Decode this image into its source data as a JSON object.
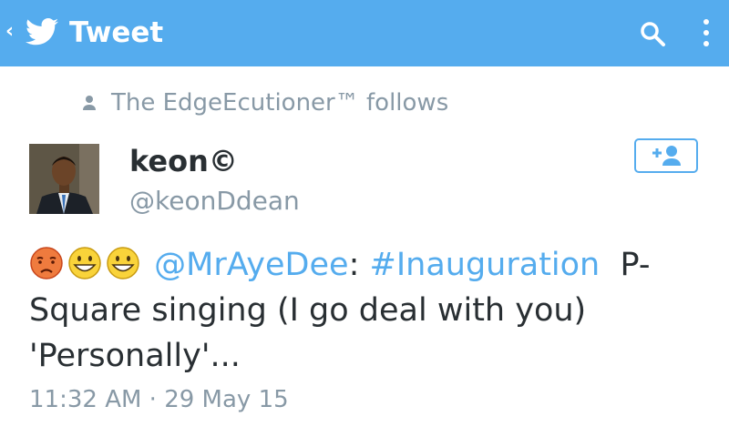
{
  "appbar": {
    "back_glyph": "‹",
    "logo_icon": "twitter-bird-icon",
    "title": "Tweet",
    "search_icon": "search-icon",
    "overflow_icon": "overflow-menu-icon",
    "bg_color": "#55acee"
  },
  "social_context": {
    "icon": "person-icon",
    "text": "The EdgeEcutioner™ follows"
  },
  "author": {
    "name": "keon©",
    "handle": "@keonDdean",
    "follow_icon": "follow-user-icon"
  },
  "tweet": {
    "emojis": [
      "disappointed-face-icon",
      "grinning-face-icon",
      "grinning-face-icon"
    ],
    "mention": "@MrAyeDee",
    "colon": ":",
    "hashtag": "#Inauguration",
    "text": "  P-Square singing (I go deal with you) 'Personally'...",
    "link_color": "#55acee"
  },
  "timestamp": "11:32 AM · 29 May 15"
}
